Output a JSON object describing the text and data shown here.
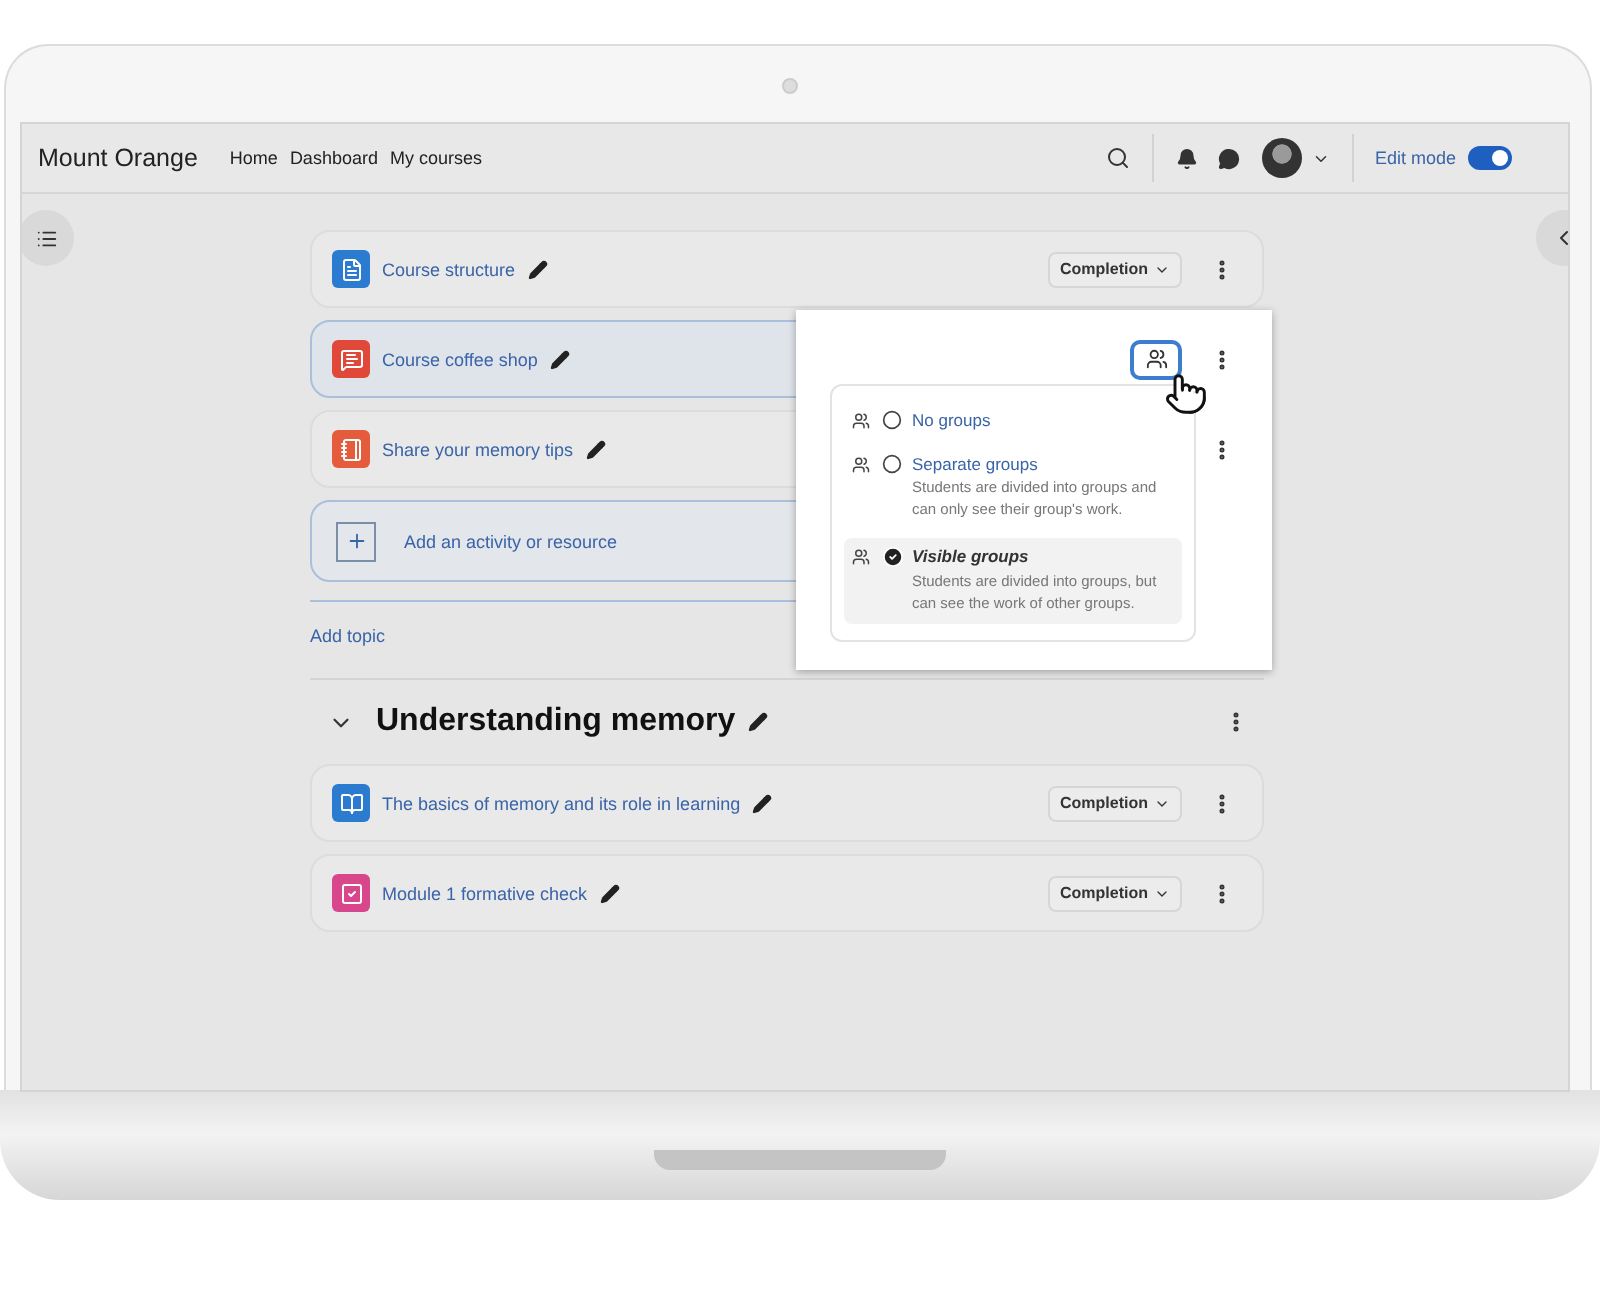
{
  "navbar": {
    "brand": "Mount Orange",
    "links": [
      "Home",
      "Dashboard",
      "My courses"
    ],
    "edit_mode": {
      "label": "Edit mode",
      "on": true
    }
  },
  "topic": {
    "activities": [
      {
        "name": "Course structure",
        "kind": "page",
        "control": {
          "kind": "completion",
          "label": "Completion"
        }
      },
      {
        "name": "Course coffee shop",
        "kind": "forum",
        "control": {
          "kind": "groups"
        },
        "focused": true
      },
      {
        "name": "Share your memory tips",
        "kind": "assignment"
      }
    ],
    "add_activity": "Add an activity or resource"
  },
  "group_menu": {
    "options": [
      {
        "label": "No groups",
        "selected": false
      },
      {
        "label": "Separate groups",
        "description": "Students are divided into groups and can only see their group's work.",
        "selected": false
      },
      {
        "label": "Visible groups",
        "description": "Students are divided into groups, but can see the work of other groups.",
        "selected": true
      }
    ]
  },
  "add_topic": "Add topic",
  "section": {
    "title": "Understanding memory",
    "expanded": true,
    "activities": [
      {
        "name": "The basics of memory and its role in learning",
        "kind": "book",
        "control": {
          "kind": "completion",
          "label": "Completion"
        }
      },
      {
        "name": "Module 1 formative check",
        "kind": "quiz",
        "control": {
          "kind": "completion",
          "label": "Completion"
        }
      }
    ]
  }
}
